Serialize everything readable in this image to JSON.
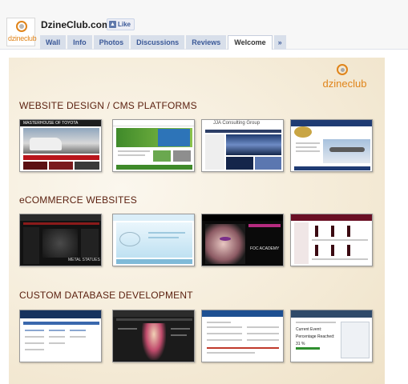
{
  "header": {
    "page_name": "DzineClub.com",
    "logo_text": "dzineclub",
    "like_label": "Like"
  },
  "tabs": [
    {
      "label": "Wall",
      "active": false
    },
    {
      "label": "Info",
      "active": false
    },
    {
      "label": "Photos",
      "active": false
    },
    {
      "label": "Discussions",
      "active": false
    },
    {
      "label": "Reviews",
      "active": false
    },
    {
      "label": "Welcome",
      "active": true
    }
  ],
  "more_tabs_label": "»",
  "panel": {
    "brand_text": "dzineclub",
    "sections": [
      {
        "title": "WEBSITE DESIGN / CMS PLATFORMS",
        "thumbnails": [
          {
            "name": "vehicle-dealer-site",
            "caption": "MASTERHOUSE OF TOYOTA"
          },
          {
            "name": "green-corporate-site",
            "caption": ""
          },
          {
            "name": "jja-consulting-site",
            "caption": "JJA Consulting Group"
          },
          {
            "name": "aviation-association-site",
            "caption": ""
          }
        ]
      },
      {
        "title": "eCOMMERCE WEBSITES",
        "thumbnails": [
          {
            "name": "metal-statues-shop",
            "caption": "METAL STATUES"
          },
          {
            "name": "jewellery-shop",
            "caption": ""
          },
          {
            "name": "beauty-academy-site",
            "caption": "FOC ACADEMY"
          },
          {
            "name": "wine-shop",
            "caption": ""
          }
        ]
      },
      {
        "title": "CUSTOM DATABASE DEVELOPMENT",
        "thumbnails": [
          {
            "name": "database-table-app",
            "caption": ""
          },
          {
            "name": "media-portal-app",
            "caption": ""
          },
          {
            "name": "registration-form-app",
            "caption": ""
          },
          {
            "name": "admin-area-app",
            "caption": "Current Event: Percentage Reached: 31 %"
          }
        ]
      }
    ]
  },
  "colors": {
    "facebook_blue": "#3b5998",
    "tab_background": "#d8dfea",
    "brand_orange": "#e0841a",
    "section_title": "#5a1f0e"
  }
}
